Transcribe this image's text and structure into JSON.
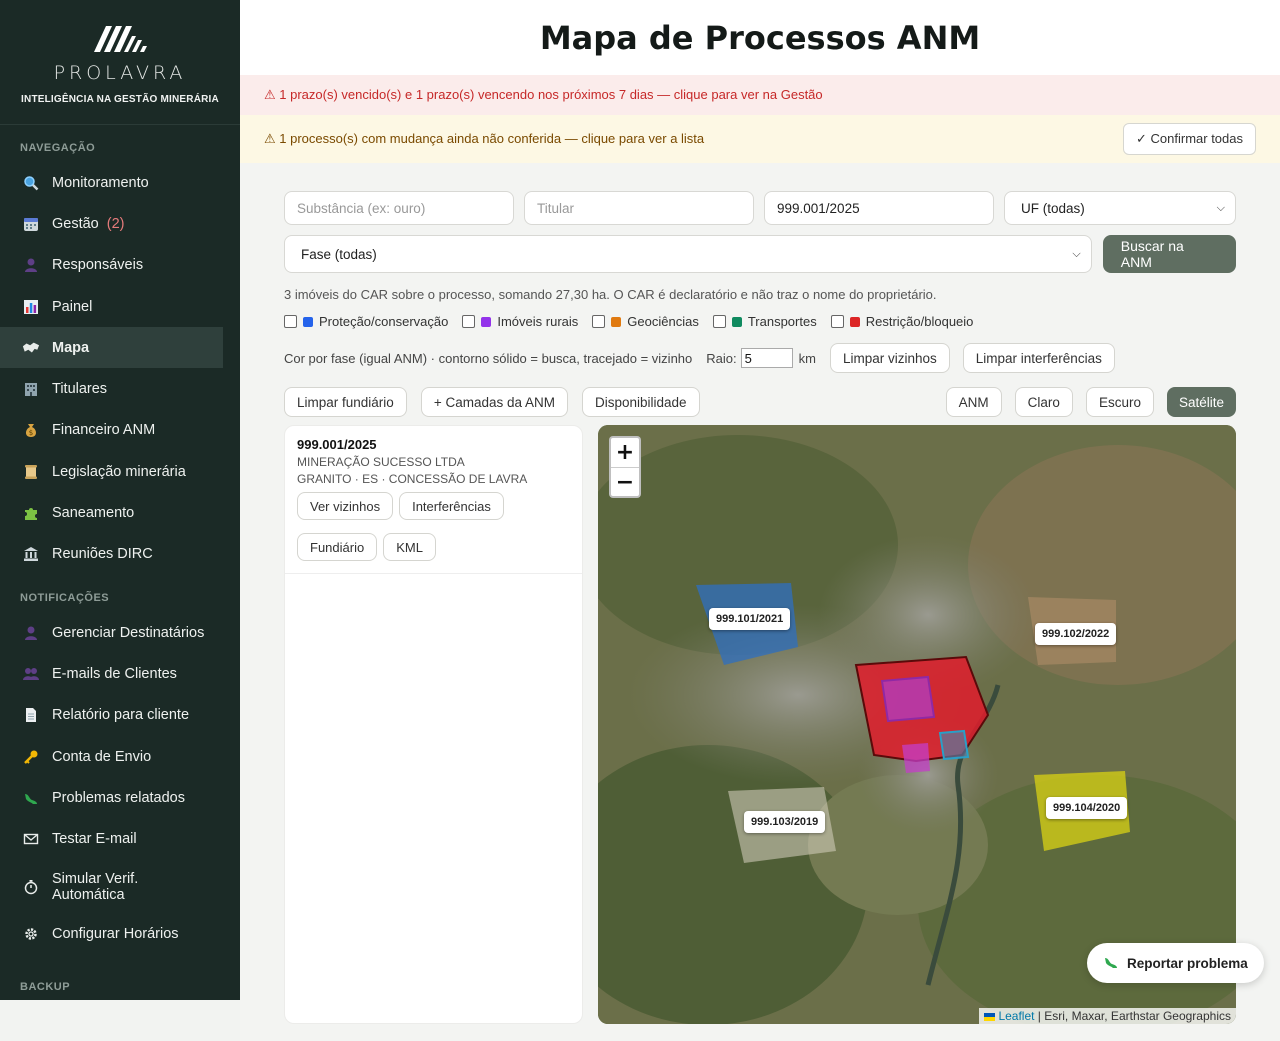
{
  "brand": {
    "name": "PROLAVRA",
    "tagline": "INTELIGÊNCIA NA GESTÃO MINERÁRIA"
  },
  "sidebar": {
    "sections": [
      {
        "title": "NAVEGAÇÃO"
      },
      {
        "title": "NOTIFICAÇÕES"
      },
      {
        "title": "BACKUP"
      }
    ],
    "nav": [
      {
        "label": "Monitoramento",
        "icon": "magnifier-icon"
      },
      {
        "label": "Gestão",
        "count": "(2)",
        "icon": "calendar-icon"
      },
      {
        "label": "Responsáveis",
        "icon": "person-icon"
      },
      {
        "label": "Painel",
        "icon": "bar-chart-icon"
      },
      {
        "label": "Mapa",
        "icon": "map-icon",
        "active": true
      },
      {
        "label": "Titulares",
        "icon": "building-icon"
      },
      {
        "label": "Financeiro ANM",
        "icon": "money-bag-icon"
      },
      {
        "label": "Legislação minerária",
        "icon": "scroll-icon"
      },
      {
        "label": "Saneamento",
        "icon": "puzzle-icon"
      },
      {
        "label": "Reuniões DIRC",
        "icon": "classical-building-icon"
      }
    ],
    "notif": [
      {
        "label": "Gerenciar Destinatários",
        "icon": "person-icon"
      },
      {
        "label": "E-mails de Clientes",
        "icon": "people-icon"
      },
      {
        "label": "Relatório para cliente",
        "icon": "document-icon"
      },
      {
        "label": "Conta de Envio",
        "icon": "key-icon"
      },
      {
        "label": "Problemas relatados",
        "icon": "bug-icon"
      },
      {
        "label": "Testar E-mail",
        "icon": "envelope-icon"
      },
      {
        "label": "Simular Verif. Automática",
        "icon": "stopwatch-icon"
      },
      {
        "label": "Configurar Horários",
        "icon": "gear-icon"
      }
    ]
  },
  "header": {
    "title": "Mapa de Processos ANM"
  },
  "alerts": {
    "deadline": "⚠ 1 prazo(s) vencido(s) e 1 prazo(s) vencendo nos próximos 7 dias — clique para ver na Gestão",
    "changes": "⚠ 1 processo(s) com mudança ainda não conferida — clique para ver a lista",
    "confirm_all": "✓ Confirmar todas"
  },
  "filters": {
    "substance_placeholder": "Substância (ex: ouro)",
    "holder_placeholder": "Titular",
    "process_value": "999.001/2025",
    "uf_selected": "UF (todas)",
    "phase_selected": "Fase (todas)",
    "search_button": "Buscar na ANM"
  },
  "car_info": "3 imóveis do CAR sobre o processo, somando 27,30 ha. O CAR é declaratório e não traz o nome do proprietário.",
  "layers": [
    {
      "label": "Proteção/conservação",
      "color": "#2563eb"
    },
    {
      "label": "Imóveis rurais",
      "color": "#9333ea"
    },
    {
      "label": "Geociências",
      "color": "#e07a10"
    },
    {
      "label": "Transportes",
      "color": "#0f8a5f"
    },
    {
      "label": "Restrição/bloqueio",
      "color": "#dc2626"
    }
  ],
  "neighbors": {
    "legend": "Cor por fase (igual ANM) · contorno sólido = busca, tracejado = vizinho",
    "radius_label": "Raio:",
    "radius_value": "5",
    "radius_unit": "km",
    "clear_neighbors": "Limpar vizinhos",
    "clear_interferences": "Limpar interferências"
  },
  "toolbar": {
    "clear_land": "Limpar fundiário",
    "anm_layers": "+ Camadas da ANM",
    "availability": "Disponibilidade",
    "basemaps": [
      "ANM",
      "Claro",
      "Escuro",
      "Satélite"
    ],
    "active_basemap": "Satélite"
  },
  "result": {
    "id": "999.001/2025",
    "holder": "MINERAÇÃO SUCESSO LTDA",
    "details": "GRANITO · ES · CONCESSÃO DE LAVRA",
    "buttons": [
      "Ver vizinhos",
      "Interferências",
      "Fundiário",
      "KML"
    ]
  },
  "map": {
    "zoom_in": "+",
    "zoom_out": "−",
    "labels": [
      "999.101/2021",
      "999.102/2022",
      "999.103/2019",
      "999.104/2020"
    ],
    "attribution_link": "Leaflet",
    "attribution_text": " | Esri, Maxar, Earthstar Geographics"
  },
  "report_button": "Reportar problema"
}
